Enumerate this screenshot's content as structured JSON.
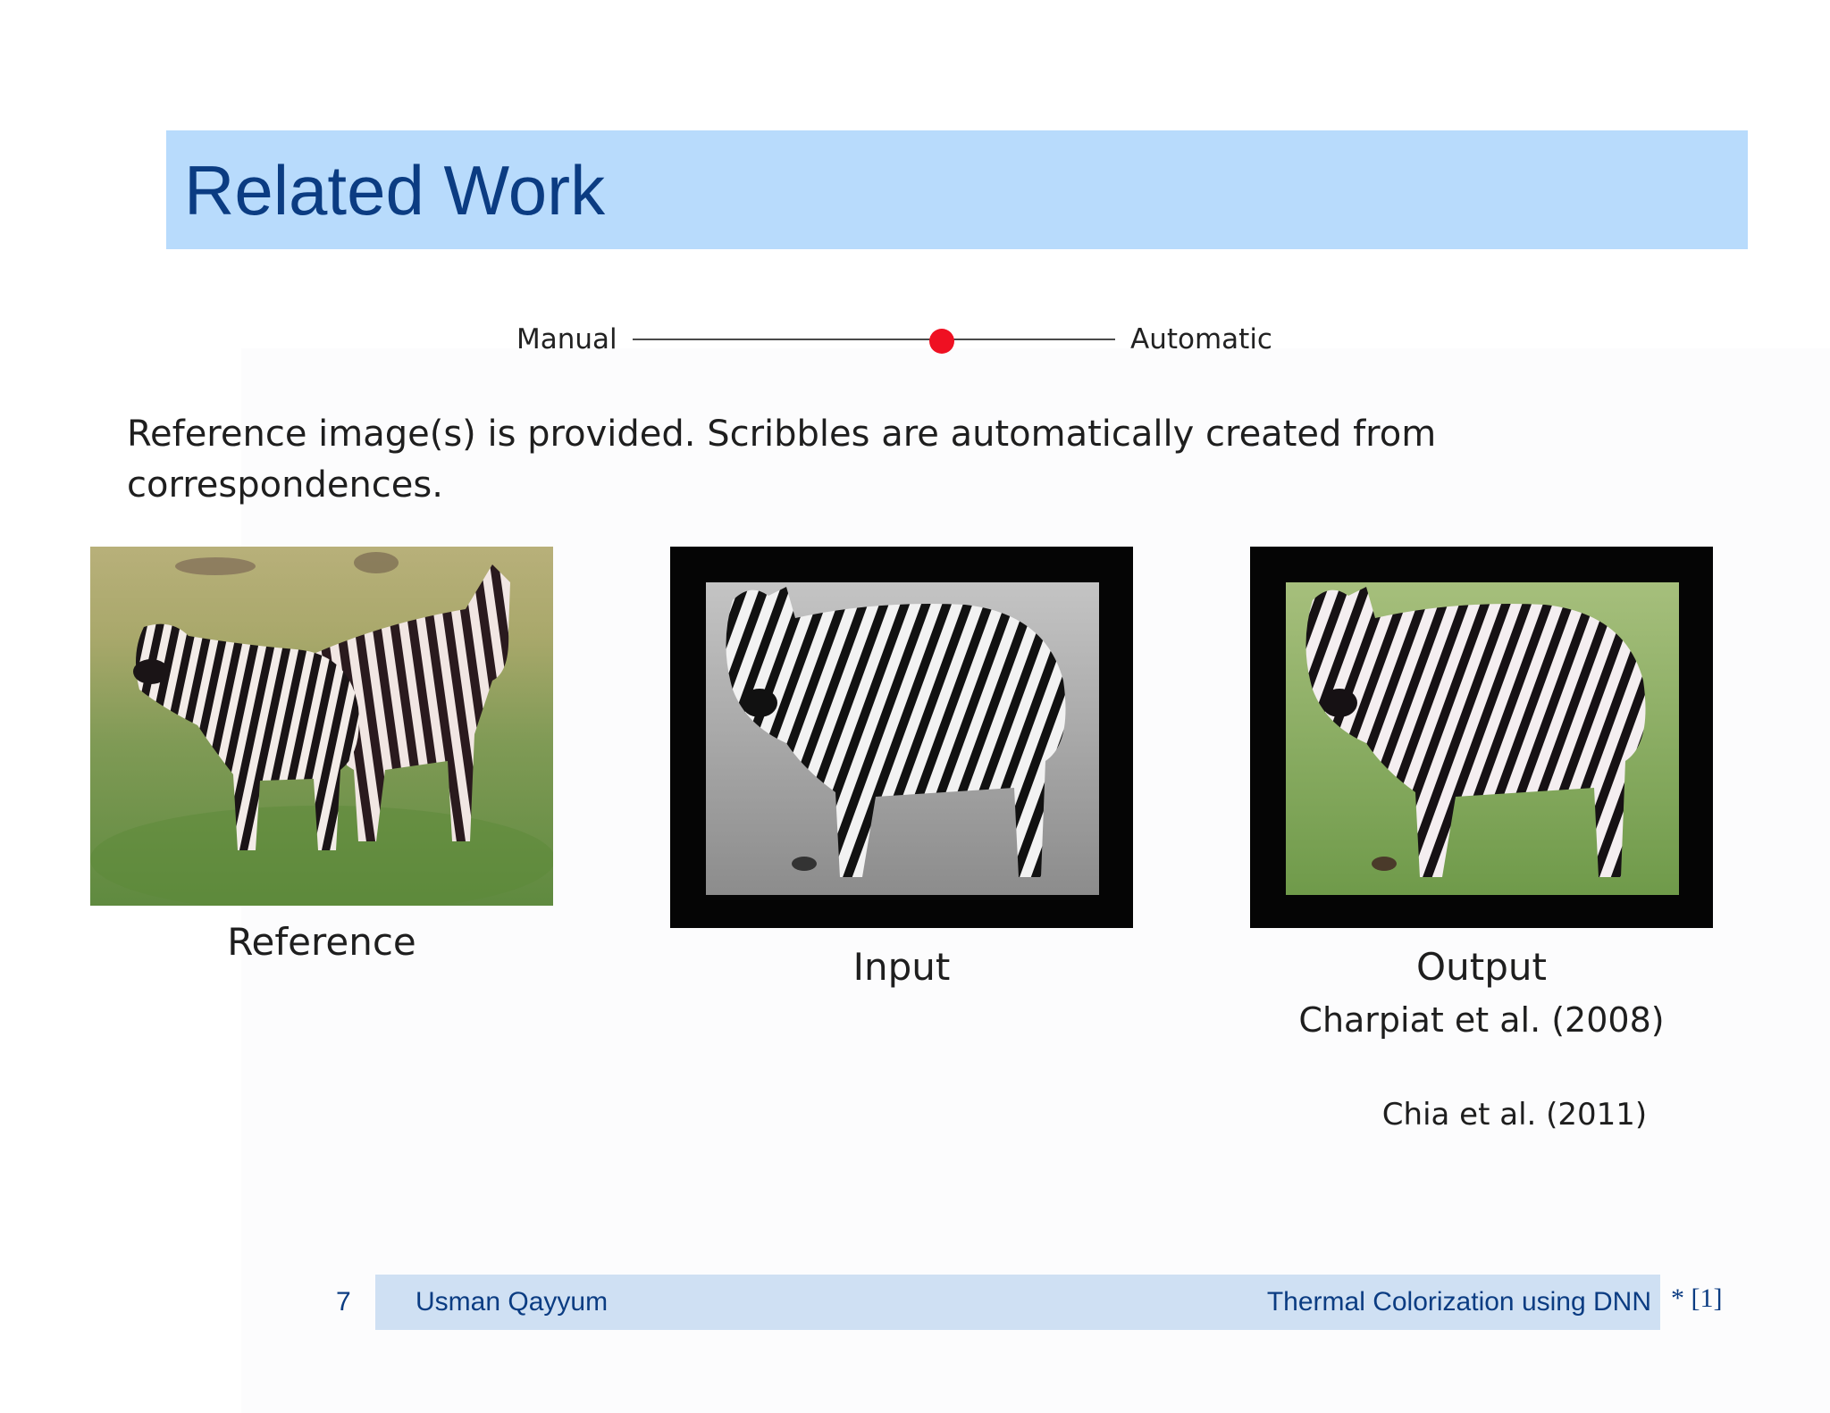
{
  "slide": {
    "title": "Related Work",
    "page_number": "7",
    "author": "Usman Qayyum",
    "talk_title": "Thermal Colorization using DNN",
    "reference_mark": "* [1]"
  },
  "slider": {
    "left_label": "Manual",
    "right_label": "Automatic",
    "level": 0.64,
    "accent_color": "#ef1022"
  },
  "description": "Reference image(s) is provided.  Scribbles are automatically created from correspondences.",
  "figures": {
    "reference_caption": "Reference",
    "input_caption": "Input",
    "output_caption": "Output",
    "output_citation": "Charpiat et al. (2008)",
    "extra_citation": "Chia et al. (2011)"
  },
  "colors": {
    "title_bar": "#b8dbfc",
    "title_text": "#0b3c82",
    "footer_bar": "#cfe0f3"
  }
}
